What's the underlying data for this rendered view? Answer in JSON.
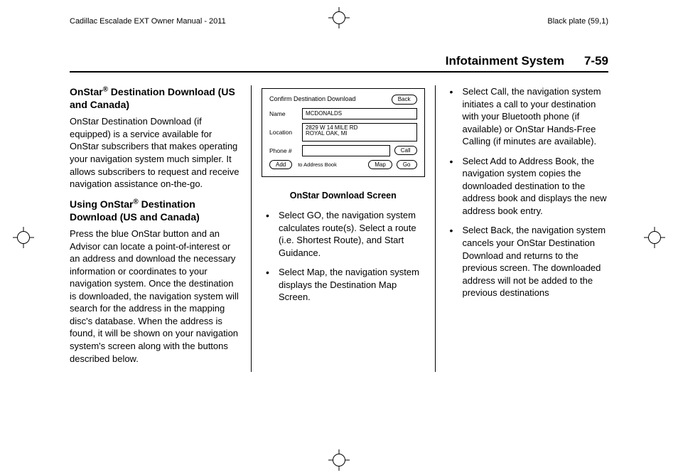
{
  "meta": {
    "left_header": "Cadillac Escalade EXT Owner Manual - 2011",
    "right_header": "Black plate (59,1)"
  },
  "header": {
    "section": "Infotainment System",
    "page": "7-59"
  },
  "col1": {
    "h1": "OnStar® Destination Download (US and Canada)",
    "p1": "OnStar Destination Download (if equipped) is a service available for OnStar subscribers that makes operating your navigation system much simpler. It allows subscribers to request and receive navigation assistance on-the-go.",
    "h2": "Using OnStar® Destination Download (US and Canada)",
    "p2": "Press the blue OnStar button and an Advisor can locate a point-of-interest or an address and download the necessary information or coordinates to your navigation system. Once the destination is downloaded, the navigation system will search for the address in the mapping disc's database. When the address is found, it will be shown on your navigation system's screen along with the buttons described below."
  },
  "screen": {
    "title": "Confirm Destination Download",
    "back": "Back",
    "name_label": "Name",
    "name_value": "MCDONALDS",
    "location_label": "Location",
    "location_value_l1": "2829 W 14 MILE RD",
    "location_value_l2": "ROYAL OAK, MI",
    "phone_label": "Phone #",
    "phone_value": "",
    "call": "Call",
    "add": "Add",
    "add_label": "to Address Book",
    "map": "Map",
    "go": "Go"
  },
  "col2": {
    "caption": "OnStar Download Screen",
    "b1": "Select GO, the navigation system calculates route(s). Select a route (i.e. Shortest Route), and Start Guidance.",
    "b2": "Select Map, the navigation system displays the Destination Map Screen."
  },
  "col3": {
    "b1": "Select Call, the navigation system initiates a call to your destination with your Bluetooth phone (if available) or OnStar Hands-Free Calling (if minutes are available).",
    "b2": "Select Add to Address Book, the navigation system copies the downloaded destination to the address book and displays the new address book entry.",
    "b3": "Select Back, the navigation system cancels your OnStar Destination Download and returns to the previous screen. The downloaded address will not be added to the previous destinations"
  }
}
